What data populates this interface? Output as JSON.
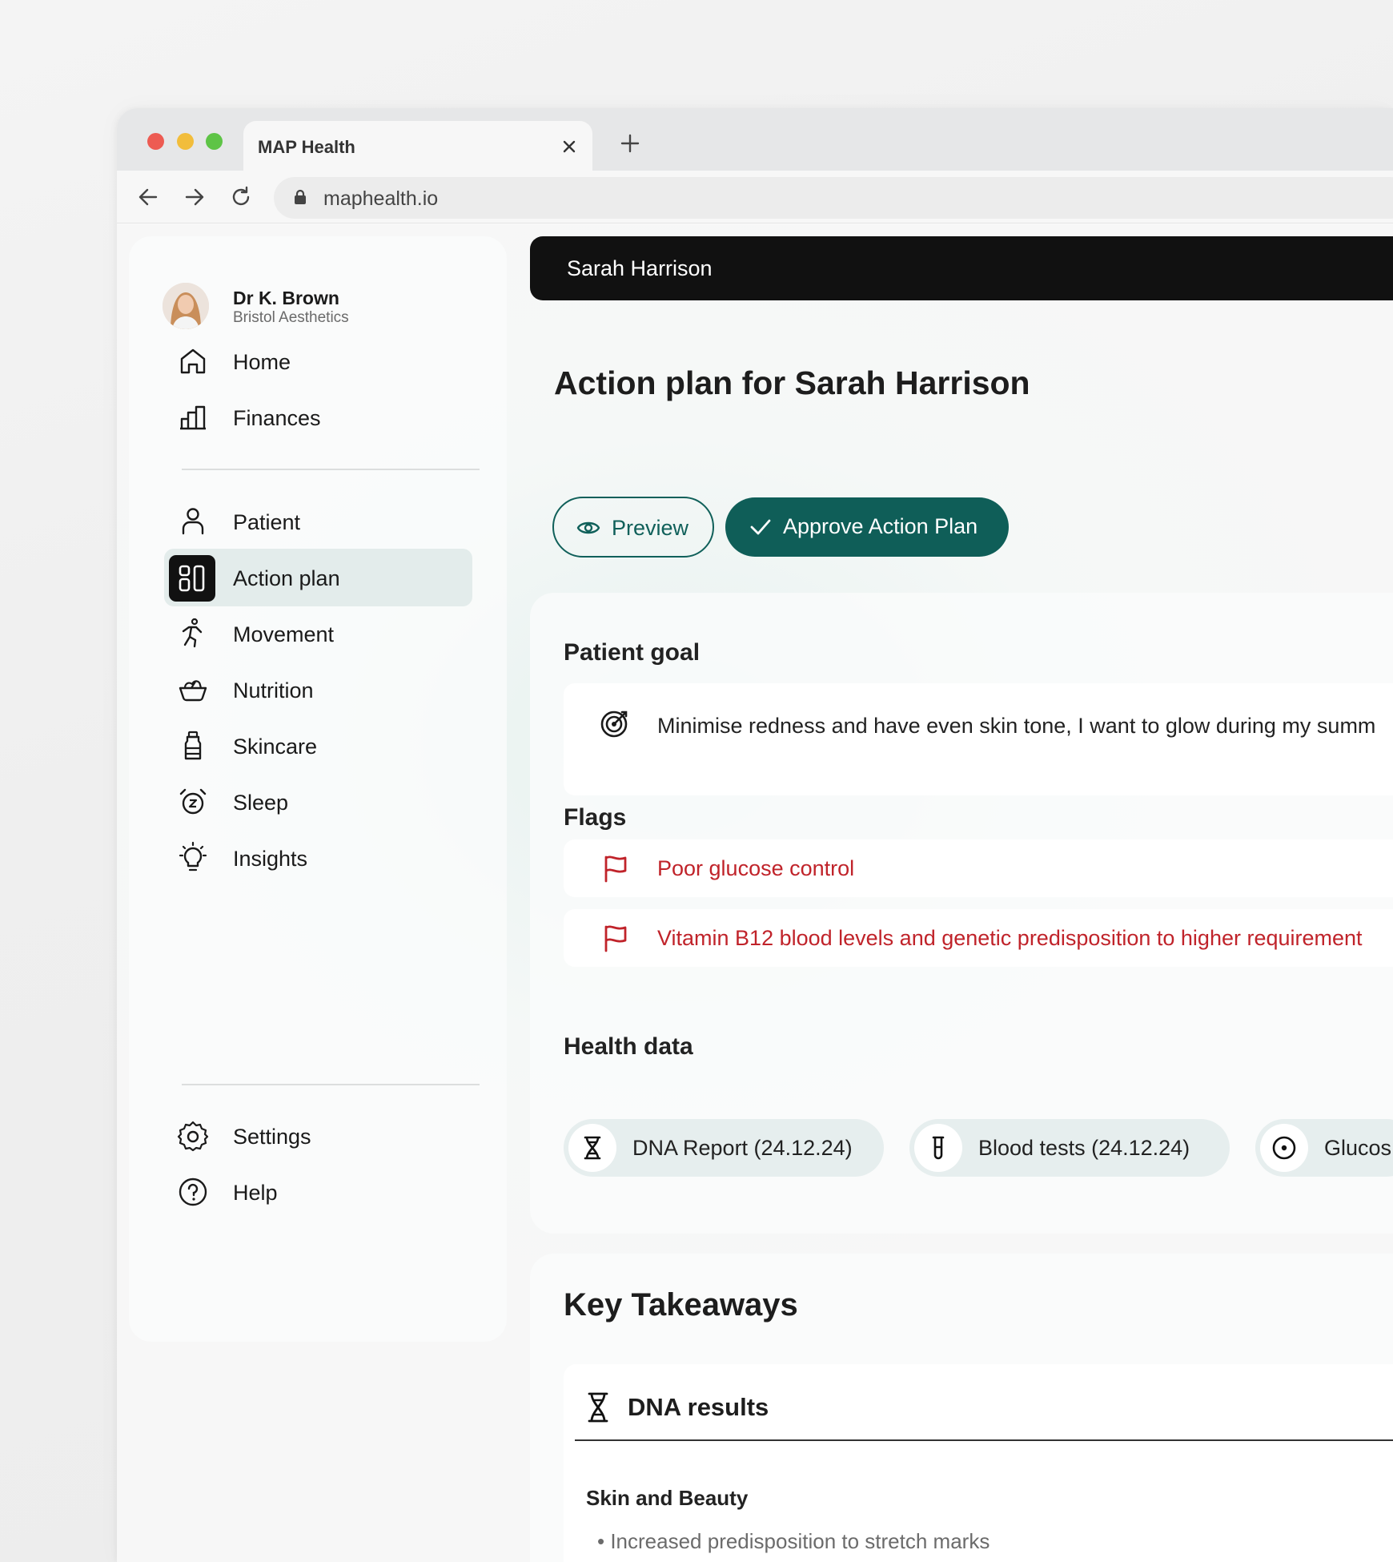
{
  "browser": {
    "tab_title": "MAP Health",
    "url": "maphealth.io"
  },
  "user": {
    "name": "Dr K. Brown",
    "clinic": "Bristol Aesthetics"
  },
  "sidebar": {
    "primary": [
      {
        "label": "Home",
        "icon": "home-icon"
      },
      {
        "label": "Finances",
        "icon": "bar-chart-icon"
      }
    ],
    "sections": [
      {
        "label": "Patient",
        "icon": "person-icon"
      },
      {
        "label": "Action plan",
        "icon": "action-plan-icon",
        "active": true
      },
      {
        "label": "Movement",
        "icon": "running-icon"
      },
      {
        "label": "Nutrition",
        "icon": "bowl-icon"
      },
      {
        "label": "Skincare",
        "icon": "bottle-icon"
      },
      {
        "label": "Sleep",
        "icon": "alarm-clock-icon"
      },
      {
        "label": "Insights",
        "icon": "lightbulb-icon"
      }
    ],
    "footer": [
      {
        "label": "Settings",
        "icon": "gear-icon"
      },
      {
        "label": "Help",
        "icon": "help-icon"
      }
    ]
  },
  "patient_bar": {
    "name": "Sarah Harrison"
  },
  "main": {
    "title": "Action plan for Sarah Harrison",
    "preview_label": "Preview",
    "approve_label": "Approve Action Plan",
    "goal_heading": "Patient goal",
    "goal_text": "Minimise redness and have even skin tone, I want to glow during my summ",
    "flags_heading": "Flags",
    "flags": [
      "Poor glucose control",
      "Vitamin B12 blood levels and genetic predisposition to higher requirement"
    ],
    "health_heading": "Health data",
    "health_chips": [
      {
        "label": "DNA Report (24.12.24)",
        "icon": "dna-icon"
      },
      {
        "label": "Blood tests (24.12.24)",
        "icon": "test-tube-icon"
      },
      {
        "label": "Glucos",
        "icon": "sensor-icon"
      }
    ],
    "takeaways_heading": "Key Takeaways",
    "dna_results_label": "DNA results",
    "skin_heading": "Skin and Beauty",
    "skin_bullets": [
      "Increased predisposition to stretch marks"
    ]
  },
  "colors": {
    "accent": "#0f5e58",
    "flag": "#c0232a",
    "dark_bar": "#111111"
  }
}
